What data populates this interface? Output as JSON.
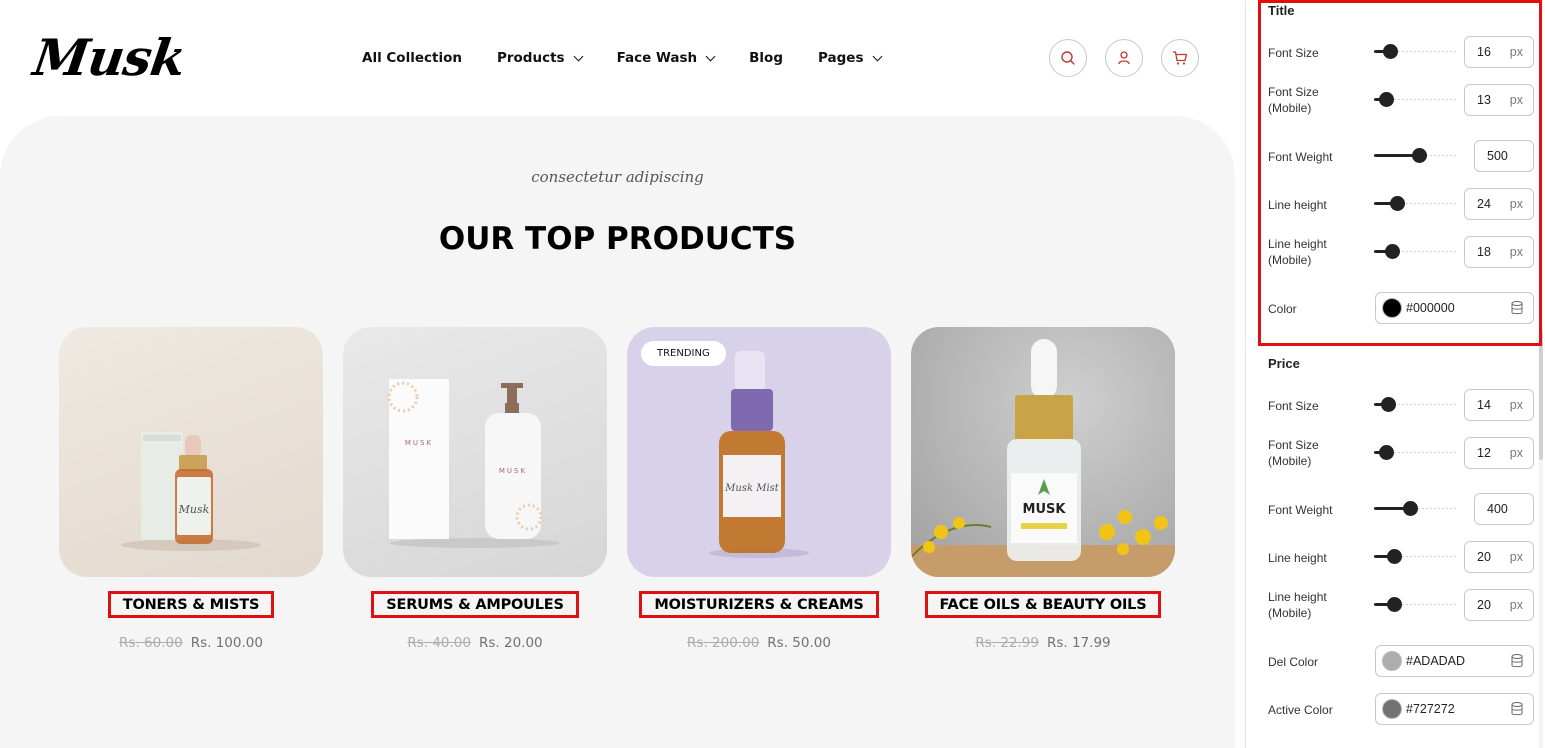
{
  "store": {
    "logo": "Musk",
    "nav": [
      {
        "label": "All Collection",
        "dropdown": false
      },
      {
        "label": "Products",
        "dropdown": true
      },
      {
        "label": "Face Wash",
        "dropdown": true
      },
      {
        "label": "Blog",
        "dropdown": false
      },
      {
        "label": "Pages",
        "dropdown": true
      }
    ],
    "header_icons": [
      "search-icon",
      "account-icon",
      "cart-icon"
    ],
    "accent_color": "#c0392b"
  },
  "section": {
    "subtitle": "consectetur adipiscing",
    "title": "OUR TOP PRODUCTS"
  },
  "products": [
    {
      "title": "TONERS & MISTS",
      "price_old": "Rs. 60.00",
      "price": "Rs. 100.00",
      "badge": "",
      "bg": "#ece6dd"
    },
    {
      "title": "SERUMS & AMPOULES",
      "price_old": "Rs. 40.00",
      "price": "Rs. 20.00",
      "badge": "",
      "bg": "#e4e4e4"
    },
    {
      "title": "MOISTURIZERS & CREAMS",
      "price_old": "Rs. 200.00",
      "price": "Rs. 50.00",
      "badge": "TRENDING",
      "bg": "#d9d2ea"
    },
    {
      "title": "FACE OILS & BEAUTY OILS",
      "price_old": "Rs. 22.99",
      "price": "Rs. 17.99",
      "badge": "",
      "bg": "#bdbdbd"
    }
  ],
  "panel": {
    "title_group": {
      "label": "Title",
      "font_size": {
        "label": "Font Size",
        "value": "16",
        "unit": "px",
        "level": 0.2
      },
      "font_size_mobile": {
        "label": "Font Size (Mobile)",
        "value": "13",
        "unit": "px",
        "level": 0.15
      },
      "font_weight": {
        "label": "Font Weight",
        "value": "500",
        "level": 0.55
      },
      "line_height": {
        "label": "Line height",
        "value": "24",
        "unit": "px",
        "level": 0.28
      },
      "line_height_mobile": {
        "label": "Line height (Mobile)",
        "value": "18",
        "unit": "px",
        "level": 0.22
      },
      "color": {
        "label": "Color",
        "value": "#000000",
        "swatch": "#000000"
      }
    },
    "price_group": {
      "label": "Price",
      "font_size": {
        "label": "Font Size",
        "value": "14",
        "unit": "px",
        "level": 0.17
      },
      "font_size_mobile": {
        "label": "Font Size (Mobile)",
        "value": "12",
        "unit": "px",
        "level": 0.15
      },
      "font_weight": {
        "label": "Font Weight",
        "value": "400",
        "level": 0.44
      },
      "line_height": {
        "label": "Line height",
        "value": "20",
        "unit": "px",
        "level": 0.24
      },
      "line_height_mobile": {
        "label": "Line height (Mobile)",
        "value": "20",
        "unit": "px",
        "level": 0.24
      },
      "del_color": {
        "label": "Del Color",
        "value": "#ADADAD",
        "swatch": "#ADADAD"
      },
      "active_color": {
        "label": "Active Color",
        "value": "#727272",
        "swatch": "#727272"
      }
    }
  }
}
